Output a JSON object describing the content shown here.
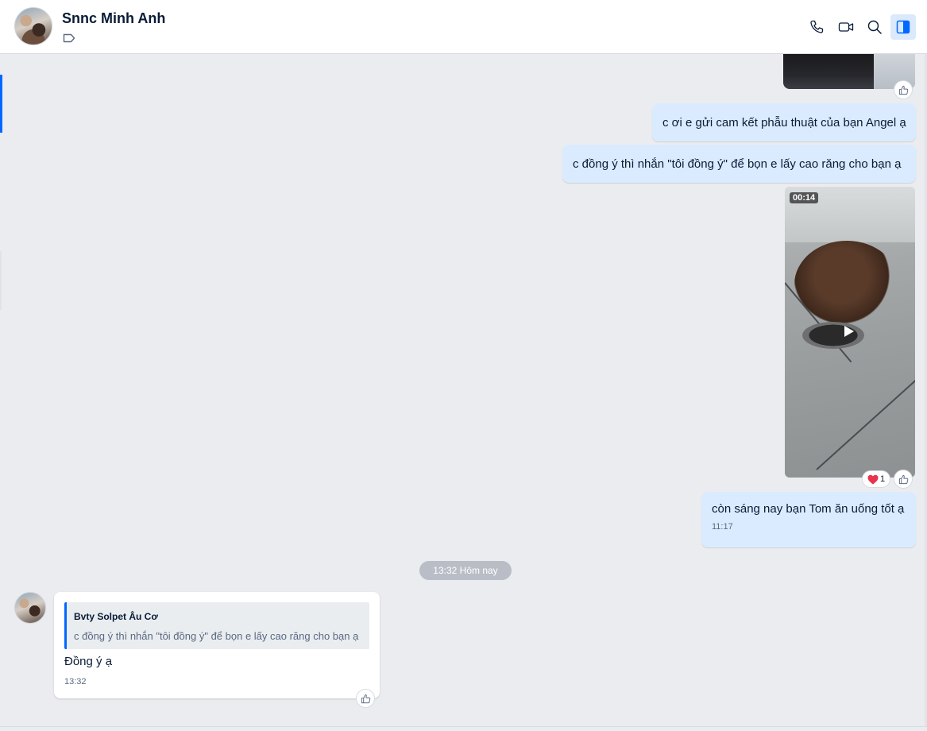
{
  "header": {
    "contact_name": "Snnc Minh Anh",
    "icons": [
      "phone-icon",
      "video-call-icon",
      "search-icon",
      "sidebar-toggle-icon"
    ]
  },
  "messages": {
    "outgoing_1": "c ơi e gửi cam kết phẫu thuật của bạn Angel ạ",
    "outgoing_2": "c đồng ý thì nhắn \"tôi đồng ý\" để bọn e lấy cao răng cho bạn ạ",
    "video_duration": "00:14",
    "video_reaction_count": "1",
    "outgoing_3": "còn sáng nay bạn Tom ăn uống tốt ạ",
    "outgoing_3_time": "11:17"
  },
  "date_divider": "13:32 Hôm nay",
  "incoming": {
    "quote_author": "Bvty Solpet Âu Cơ",
    "quote_text": "c đồng ý thì nhắn \"tôi đồng ý\" để bọn e lấy cao răng cho bạn ạ",
    "text": "Đồng ý ạ",
    "time": "13:32"
  },
  "colors": {
    "accent": "#0068ff",
    "outgoing_bubble": "#dbebff",
    "background": "#ebecf0"
  }
}
